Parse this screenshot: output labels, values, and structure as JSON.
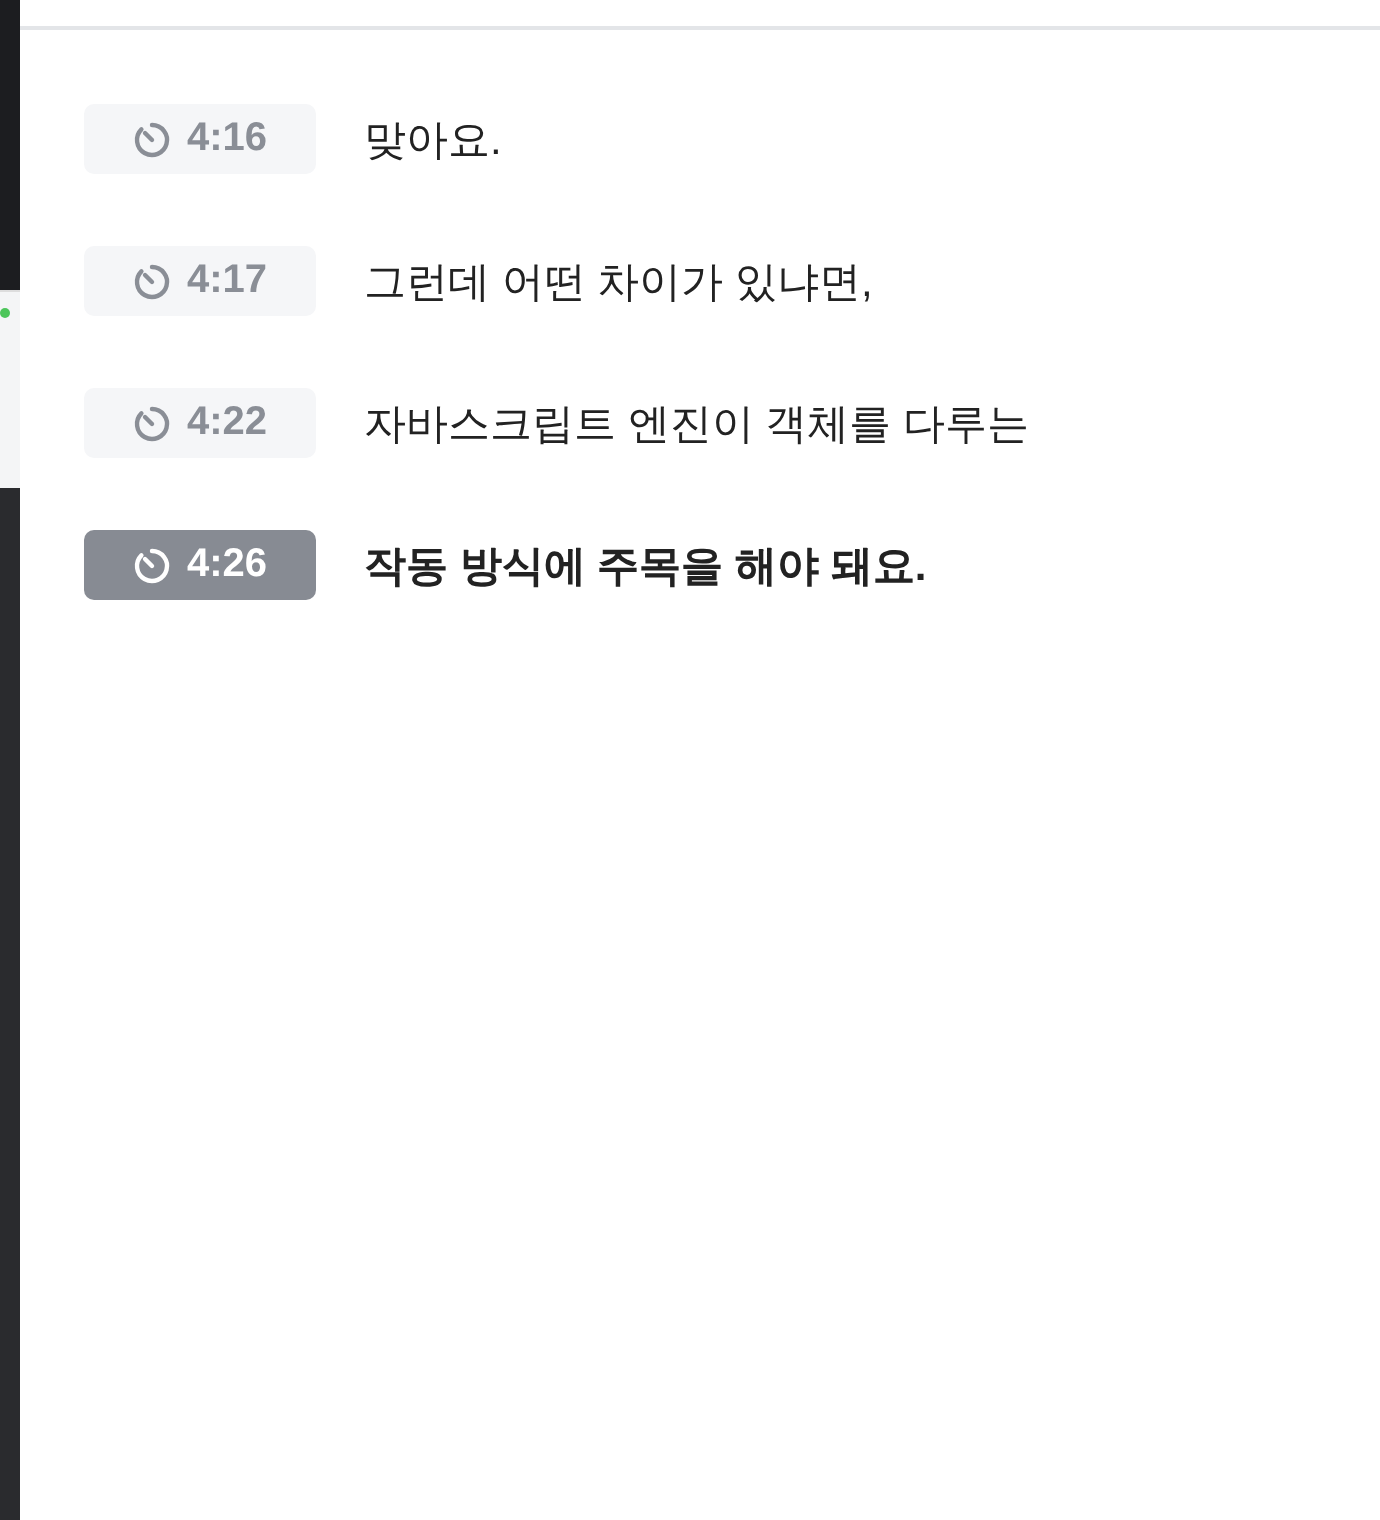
{
  "transcript": [
    {
      "time": "4:16",
      "text": "맞아요.",
      "selected": false
    },
    {
      "time": "4:17",
      "text": "그런데 어떤 차이가 있냐면,",
      "selected": false
    },
    {
      "time": "4:22",
      "text": "자바스크립트 엔진이 객체를 다루는",
      "selected": false
    },
    {
      "time": "4:26",
      "text": "작동 방식에 주목을 해야 돼요.",
      "selected": true
    }
  ]
}
